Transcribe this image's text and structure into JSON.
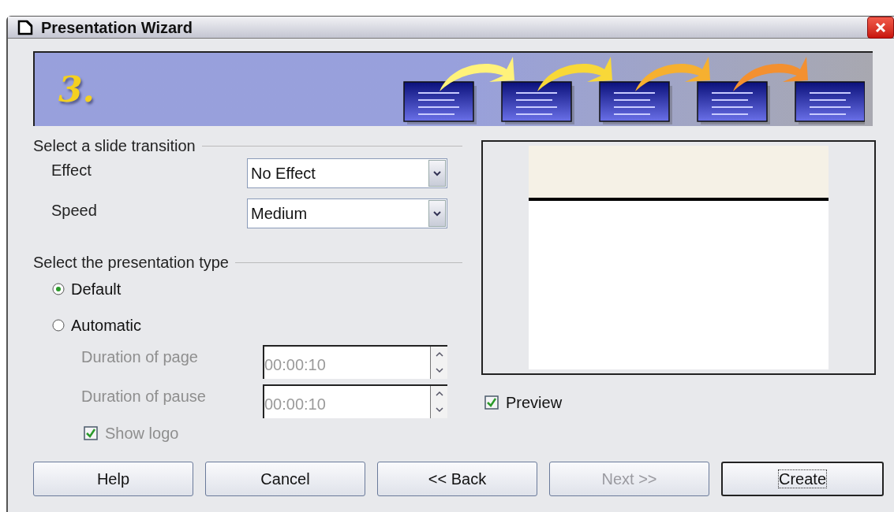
{
  "window": {
    "title": "Presentation Wizard"
  },
  "banner": {
    "step": "3."
  },
  "transition": {
    "heading": "Select a slide transition",
    "fields": [
      {
        "label": "Effect",
        "value": "No Effect"
      },
      {
        "label": "Speed",
        "value": "Medium"
      }
    ]
  },
  "presentation_type": {
    "heading": "Select the presentation type",
    "options": [
      {
        "label": "Default",
        "selected": true
      },
      {
        "label": "Automatic",
        "selected": false
      }
    ],
    "durations": [
      {
        "label": "Duration of page",
        "value": "00:00:10",
        "disabled": true
      },
      {
        "label": "Duration of pause",
        "value": "00:00:10",
        "disabled": true
      }
    ],
    "show_logo": {
      "label": "Show logo",
      "checked": true,
      "disabled": true
    }
  },
  "preview": {
    "label": "Preview",
    "checked": true
  },
  "buttons": [
    {
      "label": "Help",
      "disabled": false,
      "default": false
    },
    {
      "label": "Cancel",
      "disabled": false,
      "default": false
    },
    {
      "label": "<< Back",
      "disabled": false,
      "default": false
    },
    {
      "label": "Next >>",
      "disabled": true,
      "default": false
    },
    {
      "label": "Create",
      "disabled": false,
      "default": true
    }
  ]
}
